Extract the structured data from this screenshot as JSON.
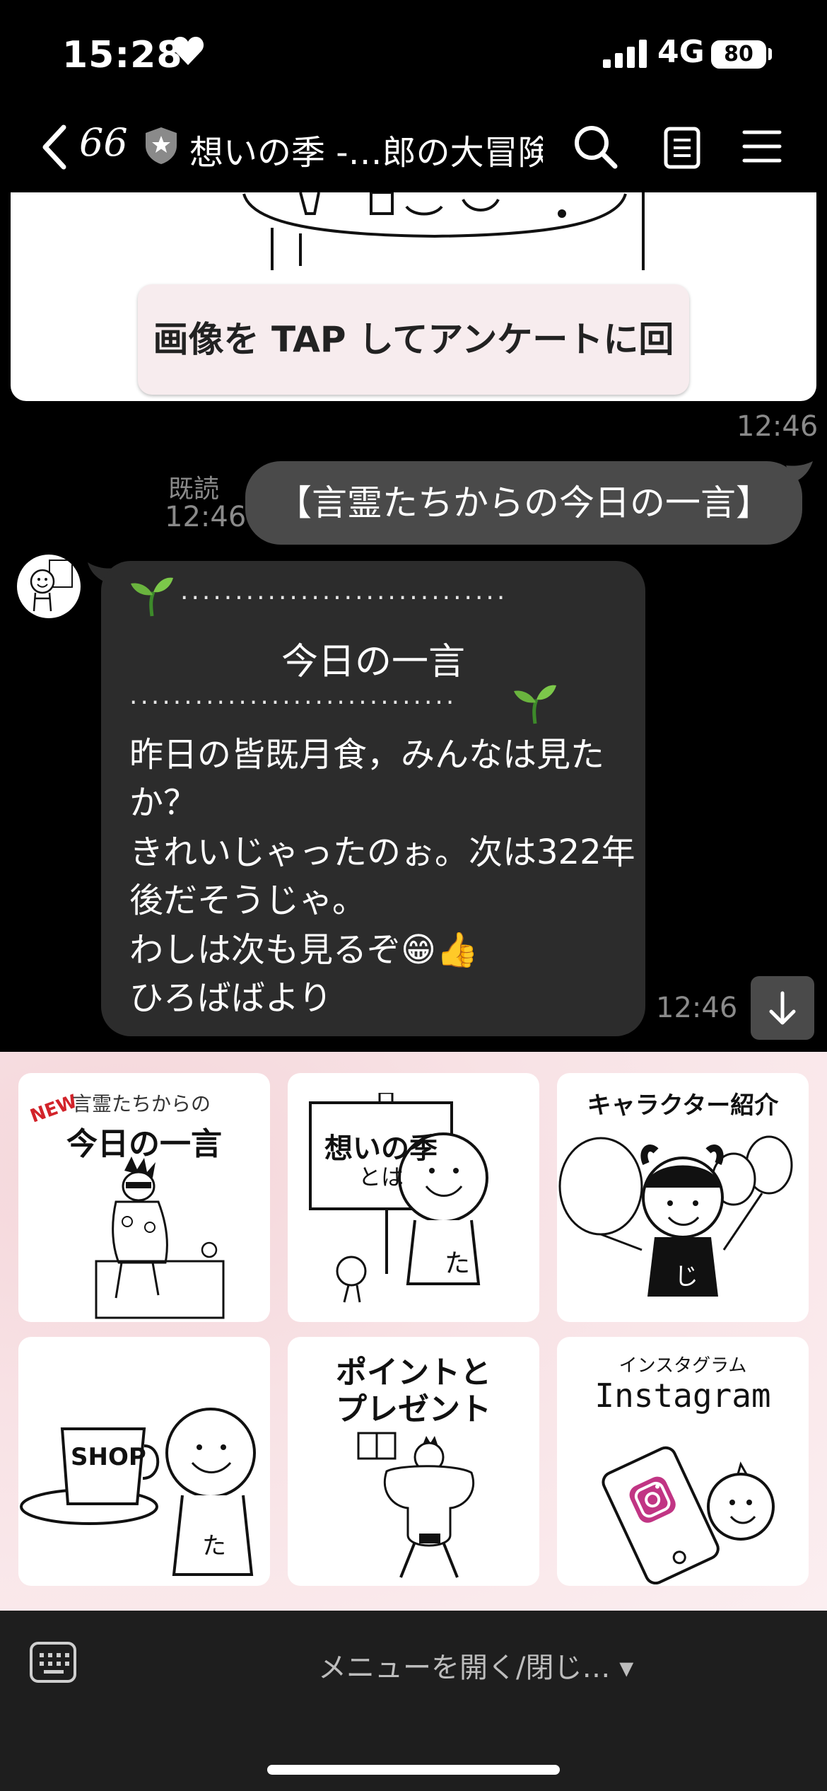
{
  "status_bar": {
    "time": "15:28",
    "network": "4G",
    "battery": "80"
  },
  "header": {
    "unread_count": "66",
    "title": "想いの季 -…郎の大冒険-"
  },
  "image_message": {
    "banner_text": "画像を TAP してアンケートに回答",
    "time": "12:46"
  },
  "sent_message": {
    "text": "【言霊たちからの今日の一言】",
    "read_label": "既読",
    "time": "12:46"
  },
  "received_message": {
    "dots_top": "..............................",
    "heading": "今日の一言",
    "dots_bottom": "..............................",
    "lines": [
      "昨日の皆既月食，みんなは見た",
      "か？",
      "きれいじゃったのぉ。次は322年",
      "後だそうじゃ。",
      "わしは次も見るぞ😁👍",
      "ひろばばより"
    ],
    "time": "12:46"
  },
  "rich_menu": {
    "tile1": {
      "new_badge": "NEW",
      "subtitle": "言霊たちからの",
      "title": "今日の一言"
    },
    "tile2": {
      "sign_line1": "想いの季",
      "sign_line2": "とは",
      "char": "た"
    },
    "tile3": {
      "title": "キャラクター紹介",
      "char": "じ"
    },
    "tile4": {
      "cup_label": "SHOP",
      "char": "た"
    },
    "tile5": {
      "line1": "ポイントと",
      "line2": "プレゼント"
    },
    "tile6": {
      "kana": "インスタグラム",
      "title": "Instagram"
    }
  },
  "bottom_bar": {
    "menu_toggle": "メニューを開く/閉じ… ▾"
  },
  "colors": {
    "bubble_sent": "#4a4a4a",
    "bubble_received": "#2c2c2c",
    "menu_bg": "#f8e2e5"
  }
}
